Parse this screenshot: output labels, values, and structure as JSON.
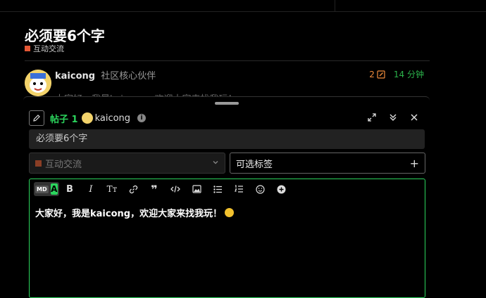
{
  "topic": {
    "title": "必须要6个字",
    "category": "互动交流",
    "category_color": "#e45735"
  },
  "post": {
    "username": "kaicong",
    "user_title": "社区核心伙伴",
    "edit_count": "2",
    "age": "14 分钟",
    "body_preview": "大家好，我是kaicong，欢迎大家来找我玩！"
  },
  "composer": {
    "reply_label": "帖子 1",
    "reply_user": "kaicong",
    "title_value": "必须要6个字",
    "category_value": "互动交流",
    "tags_placeholder": "可选标签",
    "editor_text": "大家好，我是kaicong，欢迎大家来找我玩！",
    "toggle_md": "MD",
    "toggle_a": "A",
    "toolbar": {
      "bold": "B",
      "italic": "I",
      "heading": "Tт"
    },
    "accent": "#2bd55d"
  },
  "icons": [
    "pencil-icon",
    "expand-icon",
    "collapse-icon",
    "close-icon",
    "link-icon",
    "quote-icon",
    "code-icon",
    "image-icon",
    "bullet-list-icon",
    "numbered-list-icon",
    "emoji-icon",
    "plus-circle-icon",
    "info-icon",
    "chevron-down-icon",
    "plus-icon",
    "clock-icon"
  ]
}
